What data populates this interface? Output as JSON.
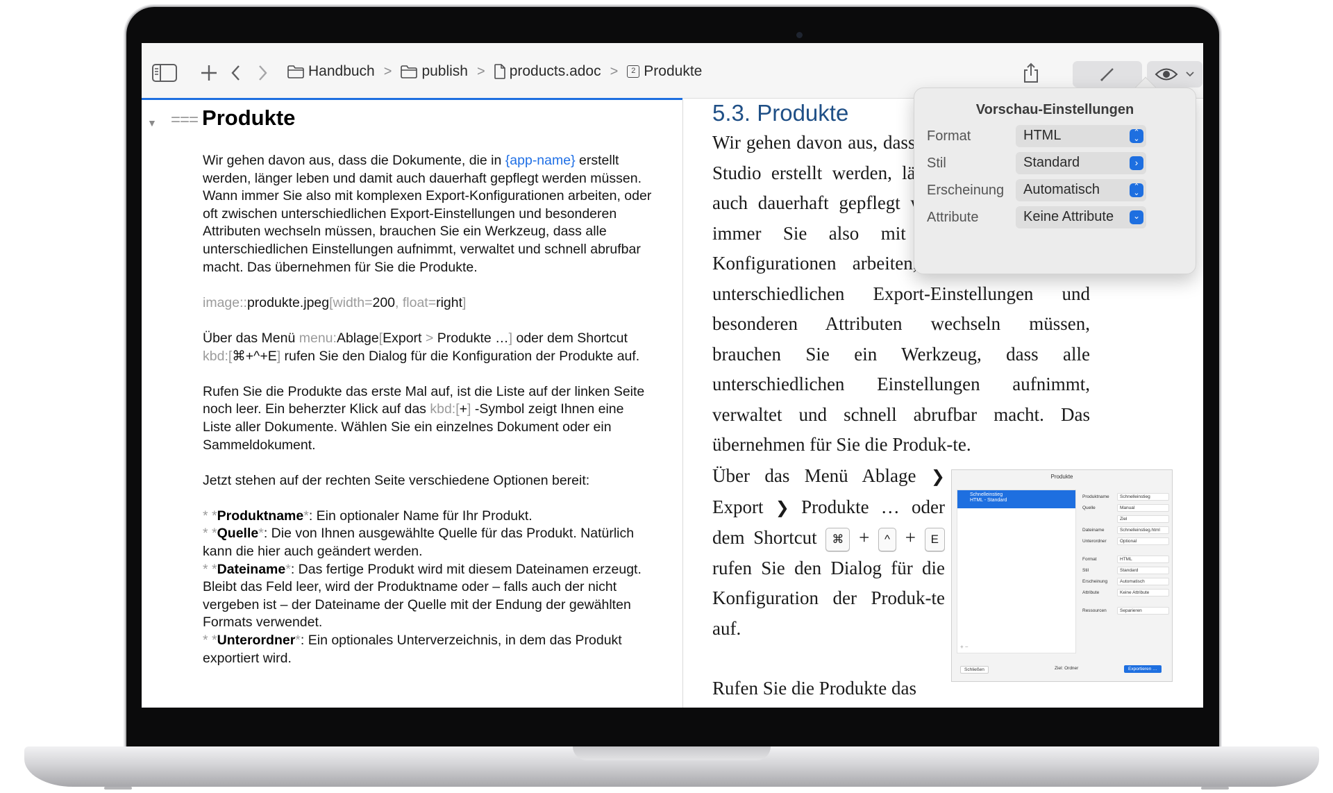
{
  "breadcrumb": {
    "items": [
      "Handbuch",
      "publish",
      "products.adoc",
      "Produkte"
    ],
    "section_number": "2",
    "separator": ">"
  },
  "editor": {
    "heading_marker": "===",
    "heading": "Produkte",
    "para1": {
      "a": "Wir gehen davon aus, dass die Dokumente, die in ",
      "attr": "{app-name}",
      "b": " erstellt werden, länger leben und damit auch dauerhaft gepflegt werden müssen. Wann immer Sie also mit komplexen Export-Konfigurationen arbeiten, oder oft zwischen unterschiedlichen Export-Einstellungen und besonderen Attributen wechseln müssen, brauchen Sie ein Werkzeug, dass alle unterschiedlichen Einstellungen aufnimmt, verwaltet und schnell abrufbar macht. Das übernehmen für Sie die Produkte."
    },
    "image_line": {
      "macro": "image::",
      "target": "produkte.jpeg",
      "open": "[",
      "k1": "width=",
      "v1": "200",
      "comma": ", ",
      "k2": "float=",
      "v2": "right",
      "close": "]"
    },
    "menu_para": {
      "a": "Über das Menü ",
      "menu_macro": "menu:",
      "menu_name": "Ablage",
      "m_open": "[",
      "m1": "Export",
      "m_sep": " > ",
      "m2": "Produkte …",
      "m_close": "]",
      "b": " oder dem Shortcut ",
      "kbd_macro": "kbd:",
      "k_open": "[",
      "keys": "⌘+^+E",
      "k_close": "]",
      "c": " rufen Sie den Dialog für die Konfiguration der Produkte auf."
    },
    "para3": {
      "a": "Rufen Sie die Produkte das erste Mal auf, ist die Liste auf der linken Seite noch leer. Ein beherzter Klick auf das ",
      "kbd_macro": "kbd:",
      "k_open": "[",
      "key": "+",
      "k_close": "]",
      "b": " -Symbol zeigt Ihnen eine Liste aller Dokumente. Wählen Sie ein einzelnes Dokument oder ein Sammeldokument."
    },
    "para4": "Jetzt stehen auf der rechten Seite verschiedene Optionen bereit:",
    "bullet_prefix": "* *",
    "bold_close": "*",
    "bullets": [
      {
        "term": "Produktname",
        "text": ": Ein optionaler Name für Ihr Produkt."
      },
      {
        "term": "Quelle",
        "text": ": Die von Ihnen ausgewählte Quelle für das Produkt. Natürlich kann die hier auch geändert werden."
      },
      {
        "term": "Dateiname",
        "text": ": Das fertige Produkt wird mit diesem Dateinamen erzeugt. Bleibt das Feld leer, wird der Produktname oder – falls auch der nicht vergeben ist – der Dateiname der Quelle mit der Endung der gewählten Formats verwendet."
      },
      {
        "term": "Unterordner",
        "text": ": Ein optionales Unterverzeichnis, in dem das Produkt exportiert wird."
      }
    ]
  },
  "preview": {
    "title": "5.3. Produkte",
    "para1": "Wir gehen davon aus, dass die Dokumente, die in Studio erstellt werden, länger leben und damit auch dauerhaft gepflegt werden müssen. Wann immer Sie also mit komplexen Export-Konfigurationen arbeiten, oder oft zwischen unterschiedlichen Export-Einstellungen und besonderen Attributen wechseln müssen, brauchen Sie ein Werkzeug, dass alle unterschiedlichen Einstellungen aufnimmt, verwaltet und schnell abrufbar macht. Das übernehmen für Sie die Produk-te.",
    "menu_para": {
      "a": "Über das Menü Ablage ",
      "chev": "❯",
      "m1": "Export",
      "m2": "Produkte …",
      "b": " oder dem Shortcut ",
      "keys": [
        "⌘",
        "^",
        "E"
      ],
      "plus": "+",
      "c": "rufen Sie den Dialog für die Konfiguration der Produk-te auf."
    },
    "para3_start": "Rufen Sie die Produkte das",
    "thumbnail": {
      "title": "Produkte",
      "selected_name": "Schnelleinstieg",
      "selected_sub": "HTML - Standard",
      "rows": [
        {
          "label": "Produktname",
          "value": "Schnelleinstieg"
        },
        {
          "label": "Quelle",
          "value": "Manual"
        },
        {
          "label": "",
          "value": "Ziel"
        },
        {
          "label": "Dateiname",
          "value": "Schnelleinstieg.html"
        },
        {
          "label": "Unterordner",
          "value": "Optional"
        },
        {
          "label": "Format",
          "value": "HTML"
        },
        {
          "label": "Stil",
          "value": "Standard"
        },
        {
          "label": "Erscheinung",
          "value": "Automatisch"
        },
        {
          "label": "Attribute",
          "value": "Keine Attribute"
        },
        {
          "label": "Ressourcen",
          "value": "Separieren"
        }
      ],
      "plus_minus": "+ −",
      "close_button": "Schließen",
      "target_label": "Ziel:",
      "target_value": "Ordner",
      "export_button": "Exportieren …"
    }
  },
  "popover": {
    "title": "Vorschau-Einstellungen",
    "rows": [
      {
        "label": "Format",
        "value": "HTML",
        "control": "stepper"
      },
      {
        "label": "Stil",
        "value": "Standard",
        "control": "arrow"
      },
      {
        "label": "Erscheinung",
        "value": "Automatisch",
        "control": "stepper"
      },
      {
        "label": "Attribute",
        "value": "Keine Attribute",
        "control": "dropdown"
      }
    ]
  },
  "icons": [
    "sidebar-toggle-icon",
    "plus-icon",
    "back-icon",
    "forward-icon",
    "folder-icon",
    "document-icon",
    "section-icon",
    "share-icon",
    "pencil-icon",
    "eye-icon",
    "chevron-down-icon"
  ],
  "colors": {
    "accent": "#1e6fe0",
    "heading_blue": "#1f4f86",
    "link_blue": "#1f6fe5",
    "markup_gray": "#9b9b9b"
  }
}
